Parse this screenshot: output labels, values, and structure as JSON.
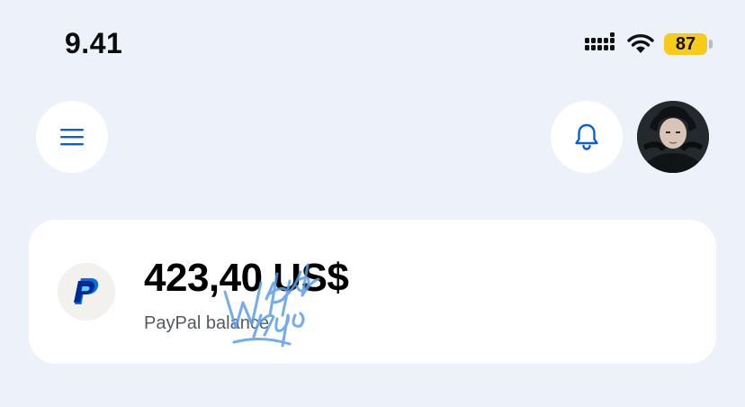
{
  "status_bar": {
    "time": "9.41",
    "battery_percent": "87",
    "icons": [
      "cellular-signal-icon",
      "wifi-icon",
      "battery-icon"
    ]
  },
  "header": {
    "menu_icon": "hamburger-menu-icon",
    "notification_icon": "bell-icon",
    "avatar": "profile-avatar"
  },
  "balance_card": {
    "amount": "423,40 US$",
    "label": "PayPal balance",
    "logo_icon": "paypal-logo-icon"
  },
  "colors": {
    "background": "#edf1fa",
    "card": "#ffffff",
    "accent_blue": "#0b5ed7",
    "battery": "#f6cb1b",
    "paypal_dark": "#002991",
    "paypal_light": "#0070e0"
  }
}
